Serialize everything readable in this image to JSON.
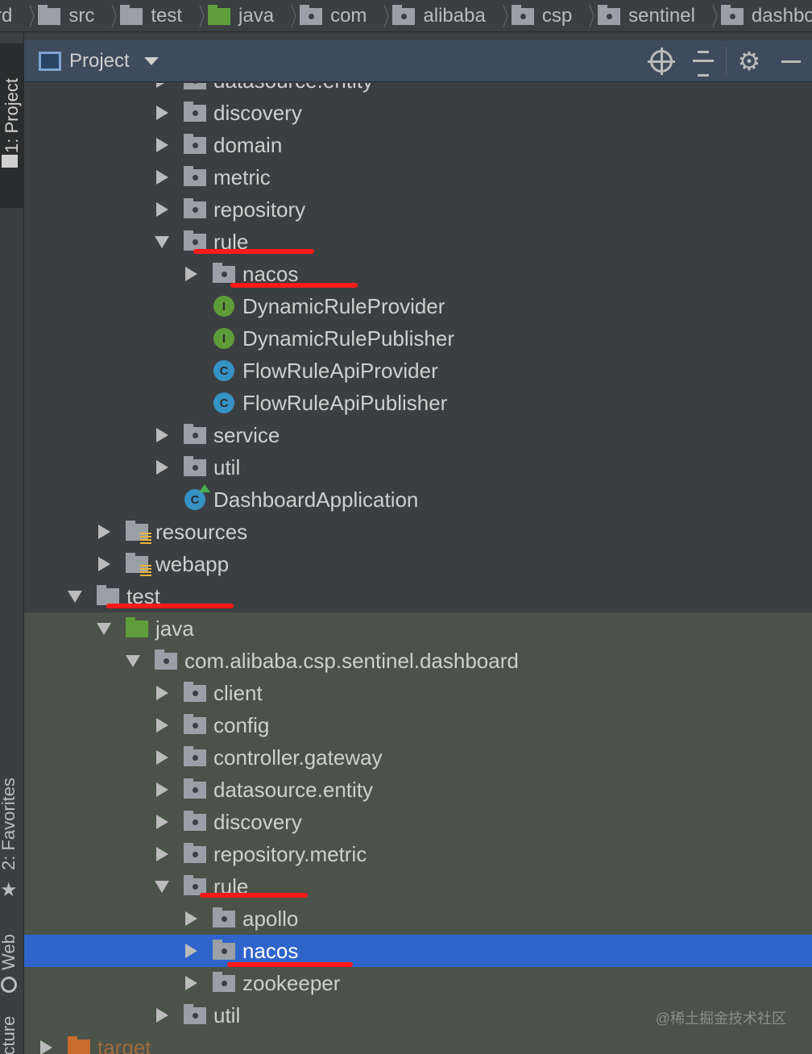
{
  "breadcrumb": [
    "rd",
    "src",
    "test",
    "java",
    "com",
    "alibaba",
    "csp",
    "sentinel",
    "dashboard"
  ],
  "toolwindows": {
    "project": "1: Project",
    "favorites": "2: Favorites",
    "web": "Web",
    "structure": "Structure"
  },
  "panel": {
    "title": "Project"
  },
  "tree": [
    {
      "label": "datasource.entity",
      "indent": 2,
      "state": "collapsed",
      "icon": "package-icon",
      "clipped": true
    },
    {
      "label": "discovery",
      "indent": 2,
      "state": "collapsed",
      "icon": "package-icon"
    },
    {
      "label": "domain",
      "indent": 2,
      "state": "collapsed",
      "icon": "package-icon"
    },
    {
      "label": "metric",
      "indent": 2,
      "state": "collapsed",
      "icon": "package-icon"
    },
    {
      "label": "repository",
      "indent": 2,
      "state": "collapsed",
      "icon": "package-icon"
    },
    {
      "label": "rule",
      "indent": 2,
      "state": "expanded",
      "icon": "package-icon"
    },
    {
      "label": "nacos",
      "indent": 3,
      "state": "collapsed",
      "icon": "package-icon"
    },
    {
      "label": "DynamicRuleProvider",
      "indent": 3,
      "state": "leaf",
      "icon": "interface-icon"
    },
    {
      "label": "DynamicRulePublisher",
      "indent": 3,
      "state": "leaf",
      "icon": "interface-icon"
    },
    {
      "label": "FlowRuleApiProvider",
      "indent": 3,
      "state": "leaf",
      "icon": "class-icon"
    },
    {
      "label": "FlowRuleApiPublisher",
      "indent": 3,
      "state": "leaf",
      "icon": "class-icon"
    },
    {
      "label": "service",
      "indent": 2,
      "state": "collapsed",
      "icon": "package-icon"
    },
    {
      "label": "util",
      "indent": 2,
      "state": "collapsed",
      "icon": "package-icon"
    },
    {
      "label": "DashboardApplication",
      "indent": 2,
      "state": "leaf",
      "icon": "spring-app-icon"
    },
    {
      "label": "resources",
      "indent": 0,
      "state": "collapsed",
      "icon": "resources-folder-icon"
    },
    {
      "label": "webapp",
      "indent": 0,
      "state": "collapsed",
      "icon": "resources-folder-icon"
    },
    {
      "label": "test",
      "indent": -1,
      "state": "expanded",
      "icon": "folder-icon"
    },
    {
      "label": "java",
      "indent": 0,
      "state": "expanded",
      "icon": "test-source-folder-icon"
    },
    {
      "label": "com.alibaba.csp.sentinel.dashboard",
      "indent": 1,
      "state": "expanded",
      "icon": "package-icon"
    },
    {
      "label": "client",
      "indent": 2,
      "state": "collapsed",
      "icon": "package-icon"
    },
    {
      "label": "config",
      "indent": 2,
      "state": "collapsed",
      "icon": "package-icon"
    },
    {
      "label": "controller.gateway",
      "indent": 2,
      "state": "collapsed",
      "icon": "package-icon"
    },
    {
      "label": "datasource.entity",
      "indent": 2,
      "state": "collapsed",
      "icon": "package-icon"
    },
    {
      "label": "discovery",
      "indent": 2,
      "state": "collapsed",
      "icon": "package-icon"
    },
    {
      "label": "repository.metric",
      "indent": 2,
      "state": "collapsed",
      "icon": "package-icon"
    },
    {
      "label": "rule",
      "indent": 2,
      "state": "expanded",
      "icon": "package-icon"
    },
    {
      "label": "apollo",
      "indent": 3,
      "state": "collapsed",
      "icon": "package-icon"
    },
    {
      "label": "nacos",
      "indent": 3,
      "state": "collapsed",
      "icon": "package-icon",
      "selected": true
    },
    {
      "label": "zookeeper",
      "indent": 3,
      "state": "collapsed",
      "icon": "package-icon"
    },
    {
      "label": "util",
      "indent": 2,
      "state": "collapsed",
      "icon": "package-icon"
    },
    {
      "label": "target",
      "indent": -2,
      "state": "collapsed",
      "icon": "excluded-folder-icon",
      "clipped": true
    }
  ],
  "watermark": "@稀土掘金技术社区",
  "colors": {
    "selection": "#2f65ca",
    "test_bg": "#4b524a",
    "annotation": "#ff1a1a"
  }
}
